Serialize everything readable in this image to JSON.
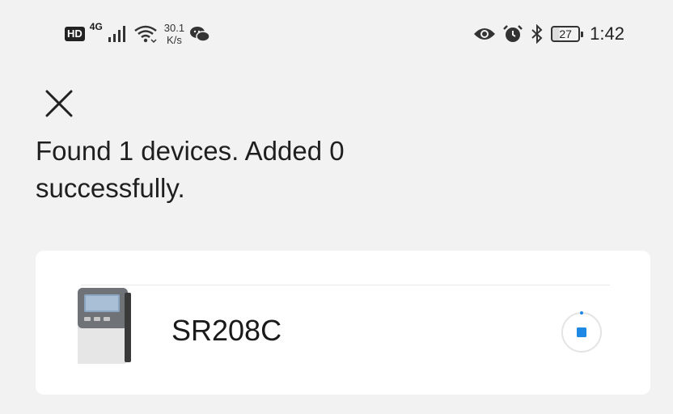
{
  "status_bar": {
    "hd": "HD",
    "network": "4G",
    "speed_value": "30.1",
    "speed_unit": "K/s",
    "battery": "27",
    "time": "1:42",
    "icons": [
      "signal-icon",
      "wifi-icon",
      "wechat-icon",
      "eye-icon",
      "alarm-icon",
      "bluetooth-icon",
      "battery-icon"
    ]
  },
  "header": {
    "close_icon": "close-icon",
    "title": "Found 1 devices. Added 0 successfully."
  },
  "devices": [
    {
      "name": "SR208C",
      "status_icon": "stop-spinner-icon"
    }
  ],
  "colors": {
    "accent": "#1e88e5",
    "background": "#f2f2f2",
    "card": "#ffffff"
  }
}
